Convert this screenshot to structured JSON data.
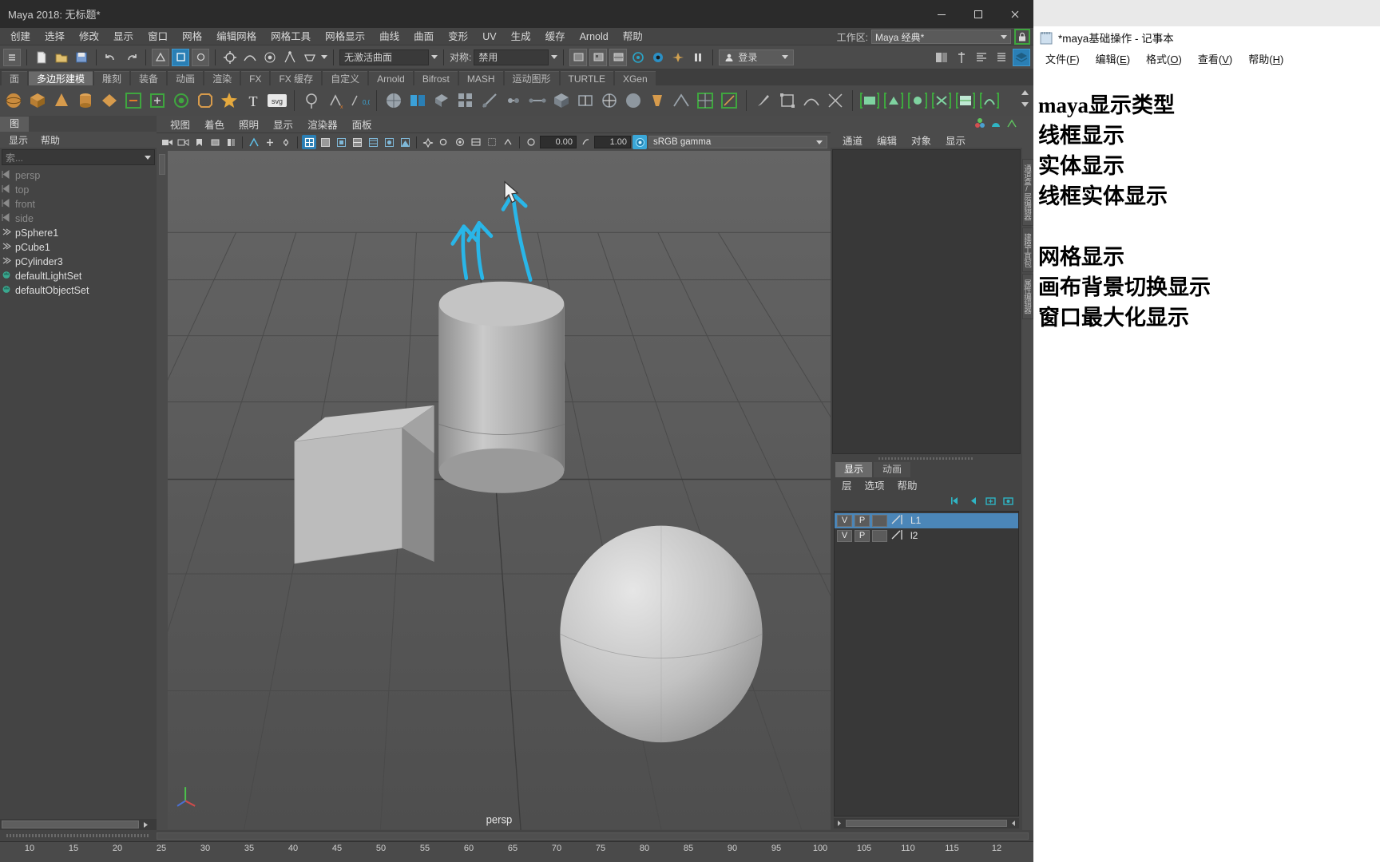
{
  "maya": {
    "title": "Maya 2018: 无标题*",
    "window_buttons": [
      "minimize",
      "maximize",
      "close"
    ],
    "menu": [
      "创建",
      "选择",
      "修改",
      "显示",
      "窗口",
      "网格",
      "编辑网格",
      "网格工具",
      "网格显示",
      "曲线",
      "曲面",
      "变形",
      "UV",
      "生成",
      "缓存",
      "Arnold",
      "帮助"
    ],
    "workspace": {
      "label": "工作区:",
      "value": "Maya 经典*"
    },
    "status_line": {
      "layer_field": "无激活曲面",
      "symmetry_label": "对称:",
      "symmetry_value": "禁用",
      "login_label": "登录"
    },
    "shelf_tabs": [
      "面",
      "多边形建模",
      "雕刻",
      "装备",
      "动画",
      "渲染",
      "FX",
      "FX 缓存",
      "自定义",
      "Arnold",
      "Bifrost",
      "MASH",
      "运动图形",
      "TURTLE",
      "XGen"
    ],
    "shelf_active": "多边形建模",
    "outliner": {
      "tab_label": "图",
      "menu": [
        "显示",
        "帮助"
      ],
      "search_placeholder": "索...",
      "items": [
        {
          "name": "persp",
          "type": "camera",
          "dim": true
        },
        {
          "name": "top",
          "type": "camera",
          "dim": true
        },
        {
          "name": "front",
          "type": "camera",
          "dim": true
        },
        {
          "name": "side",
          "type": "camera",
          "dim": true
        },
        {
          "name": "pSphere1",
          "type": "mesh",
          "dim": false
        },
        {
          "name": "pCube1",
          "type": "mesh",
          "dim": false
        },
        {
          "name": "pCylinder3",
          "type": "mesh",
          "dim": false
        },
        {
          "name": "defaultLightSet",
          "type": "set",
          "dim": false
        },
        {
          "name": "defaultObjectSet",
          "type": "set",
          "dim": false
        }
      ]
    },
    "viewport": {
      "menu": [
        "视图",
        "着色",
        "照明",
        "显示",
        "渲染器",
        "面板"
      ],
      "exposure": "0.00",
      "gamma_value": "1.00",
      "color_space": "sRGB gamma",
      "camera_label": "persp",
      "axis_label": "y"
    },
    "channel_box": {
      "menu": [
        "通道",
        "编辑",
        "对象",
        "显示"
      ]
    },
    "layer_editor": {
      "tabs": [
        "显示",
        "动画"
      ],
      "active_tab": "显示",
      "menu": [
        "层",
        "选项",
        "帮助"
      ],
      "layers": [
        {
          "v": "V",
          "p": "P",
          "name": "L1",
          "selected": true
        },
        {
          "v": "V",
          "p": "P",
          "name": "l2",
          "selected": false
        }
      ]
    },
    "side_tabs": [
      "通道盒/层编辑器",
      "建模工具包",
      "属性编辑器"
    ],
    "timeline": {
      "ticks": [
        "10",
        "15",
        "20",
        "25",
        "30",
        "35",
        "40",
        "45",
        "50",
        "55",
        "60",
        "65",
        "70",
        "75",
        "80",
        "85",
        "90",
        "95",
        "100",
        "105",
        "110",
        "115",
        "12"
      ]
    },
    "colors": {
      "accent_blue": "#2a7fb5",
      "highlight": "#4b86b8",
      "panel_bg": "#444444",
      "viewport_bg": "#5a5a5a",
      "annotation": "#29b6e8",
      "green_lock": "#3fa63f"
    }
  },
  "notepad": {
    "title": "*maya基础操作 - 记事本",
    "menu": [
      {
        "text": "文件",
        "accel": "F"
      },
      {
        "text": "编辑",
        "accel": "E"
      },
      {
        "text": "格式",
        "accel": "O"
      },
      {
        "text": "查看",
        "accel": "V"
      },
      {
        "text": "帮助",
        "accel": "H"
      }
    ],
    "lines": [
      "maya显示类型",
      "线框显示",
      "实体显示",
      "线框实体显示",
      "",
      "网格显示",
      "画布背景切换显示",
      "窗口最大化显示"
    ]
  }
}
